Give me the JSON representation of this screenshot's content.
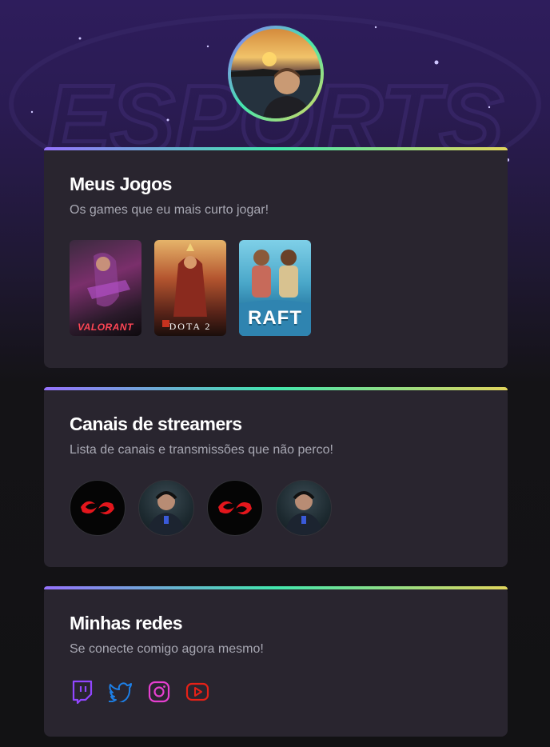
{
  "profile": {
    "avatar_alt": "profile-photo"
  },
  "games_card": {
    "title": "Meus Jogos",
    "subtitle": "Os games que eu mais curto jogar!",
    "games": [
      {
        "logo_text": "VALORANT"
      },
      {
        "logo_text": "DOTA 2"
      },
      {
        "logo_text": "RAFT"
      }
    ]
  },
  "streamers_card": {
    "title": "Canais de streamers",
    "subtitle": "Lista de canais e transmissões que não perco!"
  },
  "socials_card": {
    "title": "Minhas redes",
    "subtitle": "Se conecte comigo agora mesmo!",
    "icons": [
      "twitch-icon",
      "twitter-icon",
      "instagram-icon",
      "youtube-icon"
    ]
  },
  "colors": {
    "card_bg": "#29252f",
    "accent_gradient": [
      "#9572fc",
      "#43e7ad",
      "#e1d55d"
    ],
    "twitch": "#9146ff",
    "twitter": "#1d7fe6",
    "instagram": "#e63fd0",
    "youtube": "#e62117"
  }
}
